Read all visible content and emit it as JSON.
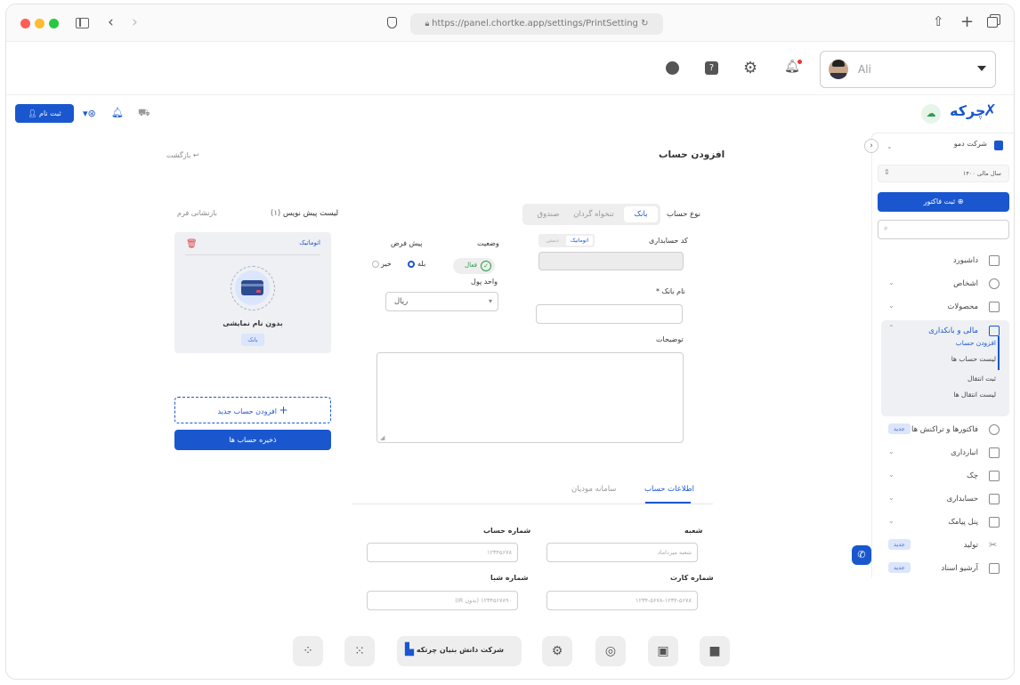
{
  "browser": {
    "url": "https://panel.chortke.app/settings/PrintSetting"
  },
  "topbar": {
    "user_name": "Ali"
  },
  "appbar": {
    "register_label": "ثبت نام",
    "brand": "چرکه"
  },
  "sidebar": {
    "company": "شرکت دمو",
    "fiscal_year": "سال مالی ۱۴۰۰",
    "new_invoice": "ثبت فاکتور",
    "items": [
      {
        "label": "داشبورد"
      },
      {
        "label": "اشخاص"
      },
      {
        "label": "محصولات"
      },
      {
        "label": "مالی و بانکداری"
      },
      {
        "label": "فاکتورها و تراکنش ها",
        "badge": "جدید"
      },
      {
        "label": "انبارداری"
      },
      {
        "label": "چک"
      },
      {
        "label": "حسابداری"
      },
      {
        "label": "پنل پیامک"
      },
      {
        "label": "تولید",
        "badge": "جدید"
      },
      {
        "label": "آرشیو اسناد",
        "badge": "جدید"
      }
    ],
    "submenu": [
      "افزودن حساب",
      "لیست حساب ها",
      "ثبت انتقال",
      "لیست انتقال ها"
    ]
  },
  "page": {
    "title": "افزودن حساب",
    "back": "بازگشت",
    "account_type_label": "نوع حساب",
    "account_types": [
      "بانک",
      "تنخواه گردان",
      "صندوق"
    ],
    "accounting_code_label": "کد حسابداری",
    "code_modes": [
      "اتوماتیک",
      "دستی"
    ],
    "status_label": "وضعیت",
    "status_value": "فعال",
    "default_label": "پیش فرض",
    "default_yes": "بله",
    "default_no": "خیر",
    "currency_label": "واحد پول",
    "currency_value": "ریال",
    "bank_name_label": "نام بانک *",
    "description_label": "توضیحات"
  },
  "drafts": {
    "title": "لیست پیش نویس",
    "count": "(۱)",
    "reset": "بازنشانی فرم",
    "card_code": "اتوماتیک",
    "card_name": "بدون نام نمایشی",
    "card_type": "بانک",
    "add_new": "افزودن حساب جدید",
    "save_all": "ذخیره حساب ها"
  },
  "info_tabs": [
    "اطلاعات حساب",
    "سامانه مودیان"
  ],
  "info_fields": {
    "branch_label": "شعبه",
    "branch_placeholder": "شعبه میرداماد",
    "account_no_label": "شماره حساب",
    "account_no_placeholder": "۱۲۳۴۵۶۷۸",
    "card_no_label": "شماره کارت",
    "card_no_placeholder": "۱۲۳۴-۵۶۷۸-۱۲۳۴-۵۶۷۸",
    "sheba_label": "شماره شبا",
    "sheba_placeholder": "۱۲۳۴۵۶۷۸۹۰ (بدون IR)"
  },
  "dock": {
    "company_label": "شرکت دانش بنیان چرتکه"
  },
  "colors": {
    "primary": "#1a57cf",
    "danger": "#e04444",
    "active_bg": "#eef0f4"
  }
}
